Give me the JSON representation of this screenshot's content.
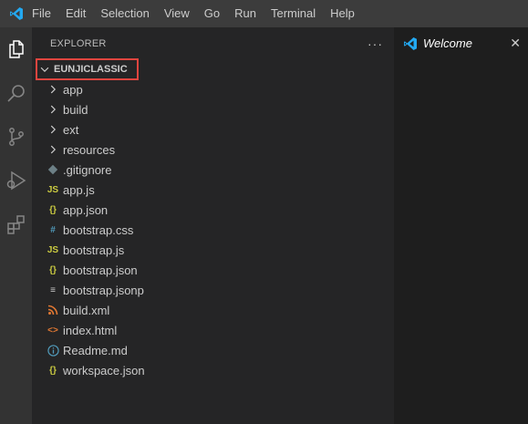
{
  "menu": [
    "File",
    "Edit",
    "Selection",
    "View",
    "Go",
    "Run",
    "Terminal",
    "Help"
  ],
  "activity": [
    "explorer-icon",
    "search-icon",
    "source-control-icon",
    "run-debug-icon",
    "extensions-icon"
  ],
  "explorer": {
    "title": "EXPLORER",
    "more": "···",
    "folder": "EUNJICLASSIC",
    "folders": [
      {
        "name": "app"
      },
      {
        "name": "build"
      },
      {
        "name": "ext"
      },
      {
        "name": "resources"
      }
    ],
    "files": [
      {
        "name": ".gitignore",
        "icon": "gitignore-icon",
        "color": "#6d8086"
      },
      {
        "name": "app.js",
        "icon": "js-icon",
        "glyph": "JS",
        "color": "#cbcb41"
      },
      {
        "name": "app.json",
        "icon": "json-icon",
        "glyph": "{}",
        "color": "#cbcb41"
      },
      {
        "name": "bootstrap.css",
        "icon": "css-icon",
        "glyph": "#",
        "color": "#519aba"
      },
      {
        "name": "bootstrap.js",
        "icon": "js-icon",
        "glyph": "JS",
        "color": "#cbcb41"
      },
      {
        "name": "bootstrap.json",
        "icon": "json-icon",
        "glyph": "{}",
        "color": "#cbcb41"
      },
      {
        "name": "bootstrap.jsonp",
        "icon": "text-file-icon",
        "glyph": "≡",
        "color": "#cccccc"
      },
      {
        "name": "build.xml",
        "icon": "rss-icon",
        "color": "#e37933"
      },
      {
        "name": "index.html",
        "icon": "html-icon",
        "glyph": "<>",
        "color": "#e37933"
      },
      {
        "name": "Readme.md",
        "icon": "info-icon",
        "glyph": "ⓘ",
        "color": "#519aba"
      },
      {
        "name": "workspace.json",
        "icon": "json-icon",
        "glyph": "{}",
        "color": "#cbcb41"
      }
    ]
  },
  "editor": {
    "tab_label": "Welcome",
    "tab_close": "✕"
  },
  "colors": {
    "accent": "#007acc",
    "highlight_border": "#e0453f"
  }
}
